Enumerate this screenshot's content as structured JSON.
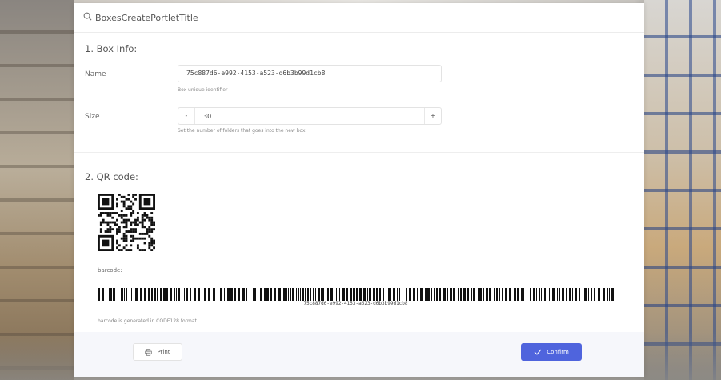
{
  "header": {
    "title": "BoxesCreatePortletTitle",
    "icon": "search-icon"
  },
  "section1": {
    "title": "1. Box Info:"
  },
  "name_field": {
    "label": "Name",
    "value": "75c887d6-e992-4153-a523-d6b3b99d1cb8",
    "hint": "Box unique identifier"
  },
  "size_field": {
    "label": "Size",
    "minus": "-",
    "value": "30",
    "plus": "+",
    "hint": "Set the number of folders that goes into the new box"
  },
  "section2": {
    "title": "2. QR code:"
  },
  "barcode": {
    "label": "barcode:",
    "text": "75c887d6-e992-4153-a523-d6b3b99d1cb8",
    "hint": "barcode is generated in CODE128 format"
  },
  "footer": {
    "print_label": "Print",
    "confirm_label": "Confirm",
    "confirm_color": "#4f64dd"
  }
}
